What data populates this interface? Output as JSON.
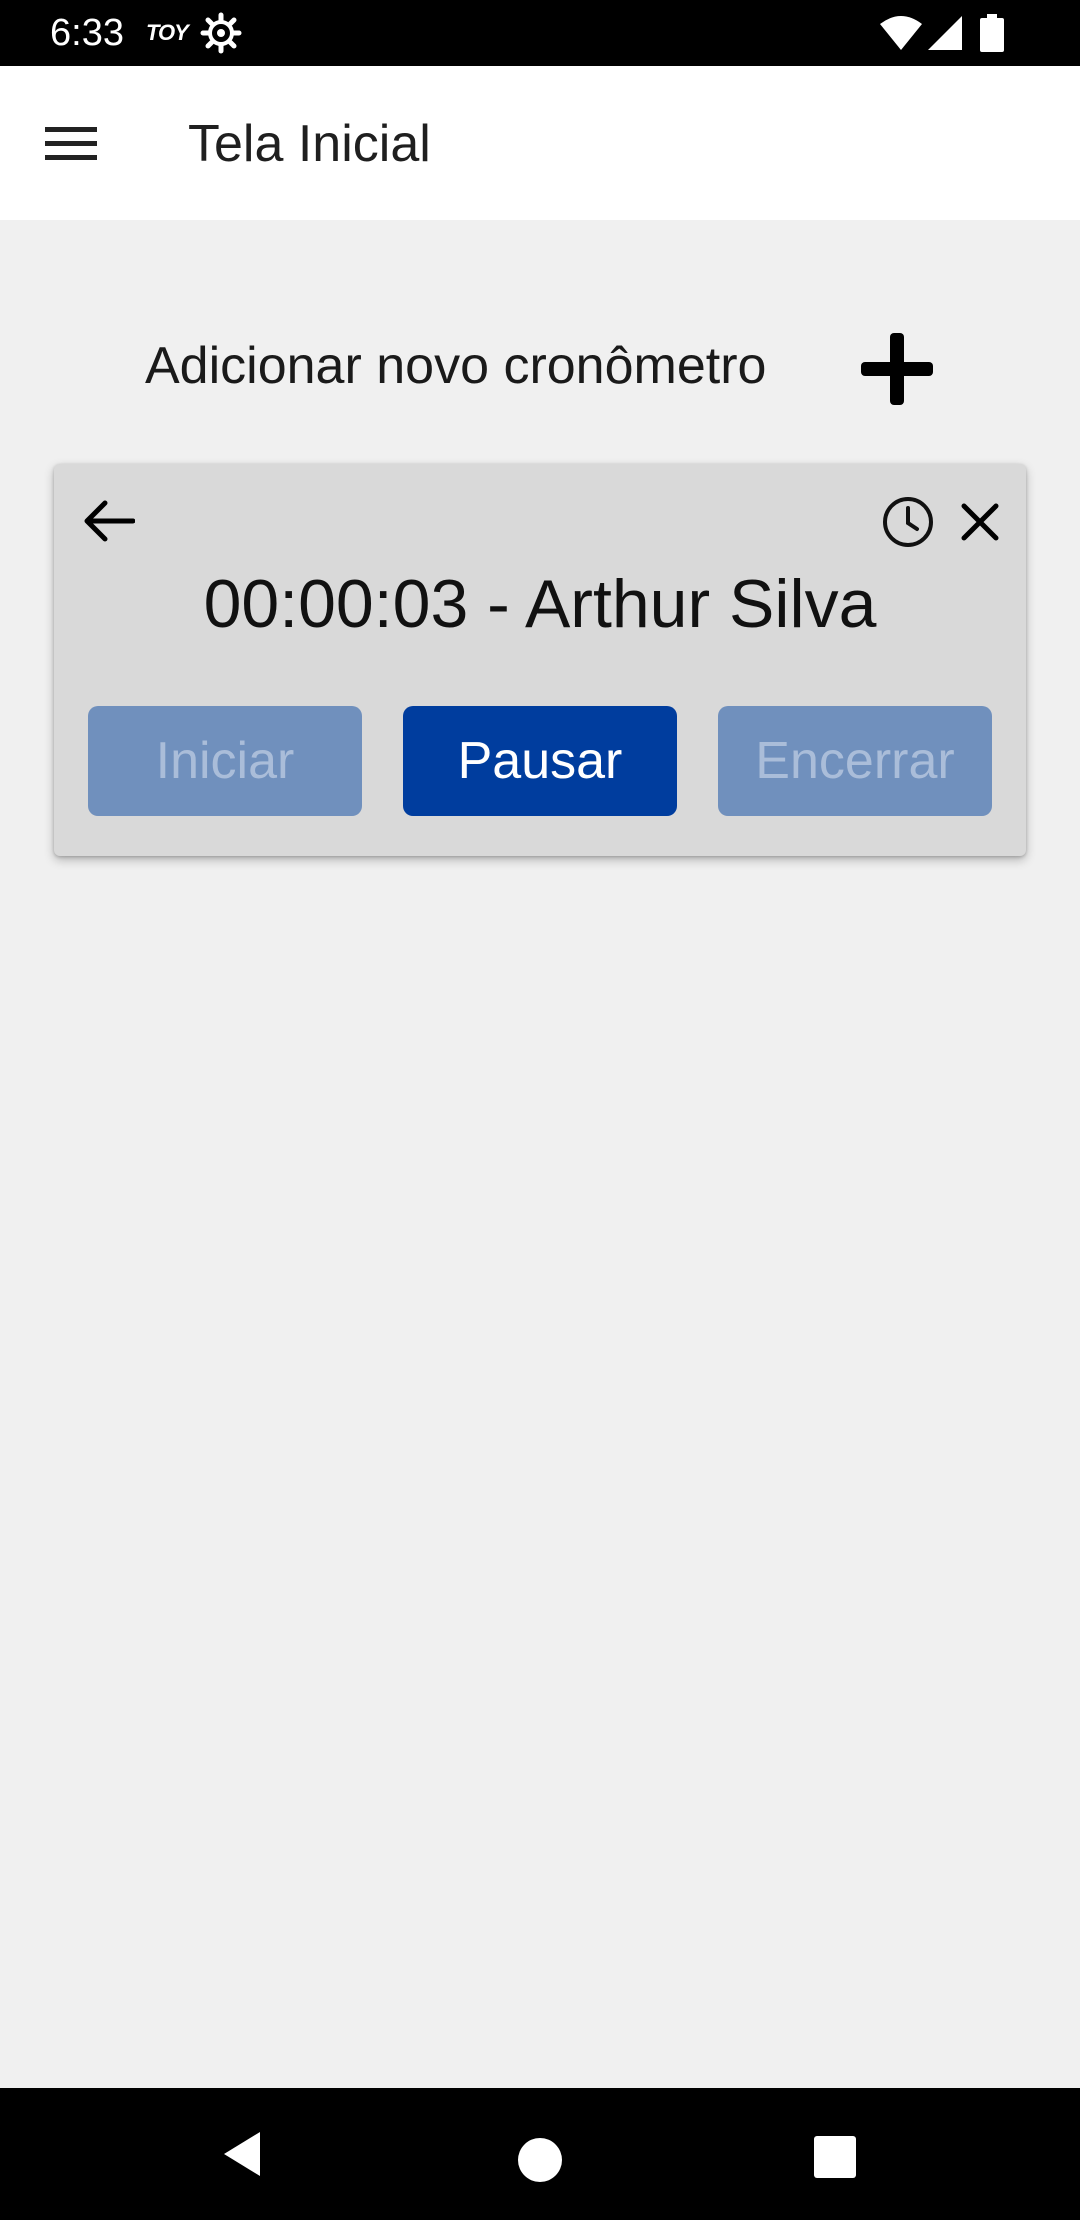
{
  "status_bar": {
    "time": "6:33",
    "carrier_badge": "TOY",
    "icons": [
      "gear-icon",
      "wifi-icon",
      "signal-icon",
      "battery-icon"
    ]
  },
  "app_bar": {
    "title": "Tela Inicial",
    "menu_icon": "hamburger-menu-icon"
  },
  "add_timer": {
    "label": "Adicionar novo cronômetro",
    "icon": "plus-icon"
  },
  "timer_card": {
    "display": "00:00:03 - Arthur Silva",
    "icons": [
      "arrow-left-icon",
      "clock-icon",
      "close-icon"
    ],
    "buttons": {
      "start": "Iniciar",
      "pause": "Pausar",
      "end": "Encerrar"
    },
    "colors": {
      "active_button": "#003d9e",
      "disabled_button": "#7090bd",
      "card_background": "#d9d9d9"
    }
  },
  "nav_bar": {
    "icons": [
      "nav-back-icon",
      "nav-home-icon",
      "nav-recents-icon"
    ]
  }
}
